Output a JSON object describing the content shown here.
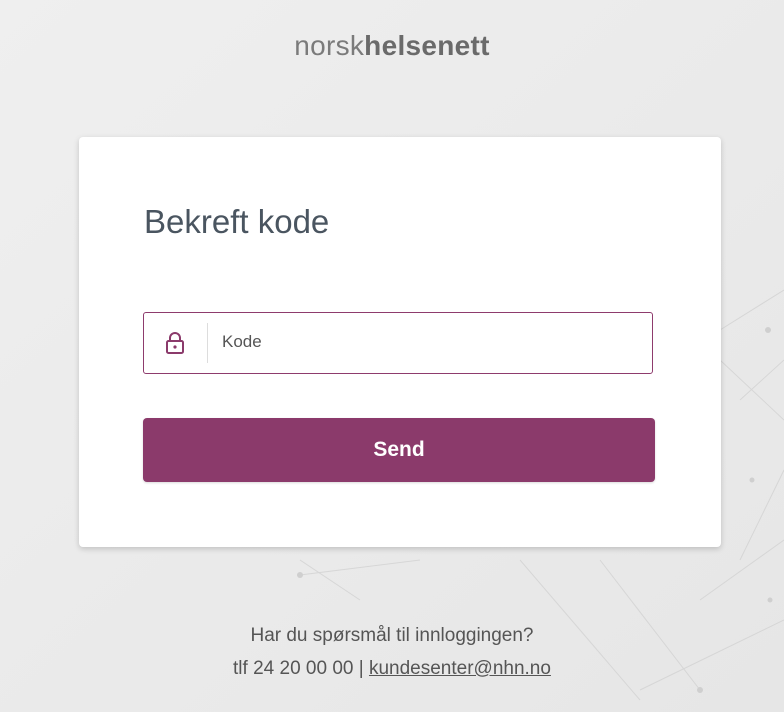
{
  "brand": {
    "light": "norsk",
    "bold": "helsenett"
  },
  "card": {
    "title": "Bekreft kode",
    "code_field": {
      "placeholder": "Kode",
      "value": "",
      "icon": "lock-icon"
    },
    "send_label": "Send"
  },
  "footer": {
    "question": "Har du spørsmål til innloggingen?",
    "phone": "tlf 24 20 00 00",
    "separator": " | ",
    "email": "kundesenter@nhn.no"
  },
  "colors": {
    "accent": "#8b3a6b",
    "background": "#ececec",
    "title": "#4a5560"
  }
}
